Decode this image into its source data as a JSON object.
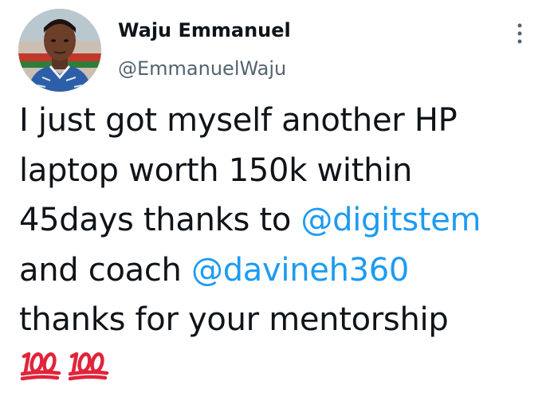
{
  "user": {
    "display_name": "Waju Emmanuel",
    "handle": "@EmmanuelWaju",
    "avatar_icon": "profile-photo"
  },
  "menu": {
    "icon": "more-vertical-icon"
  },
  "tweet": {
    "lines": [
      {
        "text": "I just got myself another HP"
      },
      {
        "text": "laptop worth 150k within"
      },
      {
        "text": "45days thanks to ",
        "mention": "@digitstem"
      },
      {
        "text": "and coach ",
        "mention": "@davineh360"
      },
      {
        "text": "thanks for your mentorship"
      }
    ],
    "emoji": [
      "hundred-points-emoji",
      "hundred-points-emoji"
    ]
  },
  "colors": {
    "text": "#0f1419",
    "secondary": "#536471",
    "mention": "#1d9bf0",
    "emoji_red": "#e0243a"
  }
}
